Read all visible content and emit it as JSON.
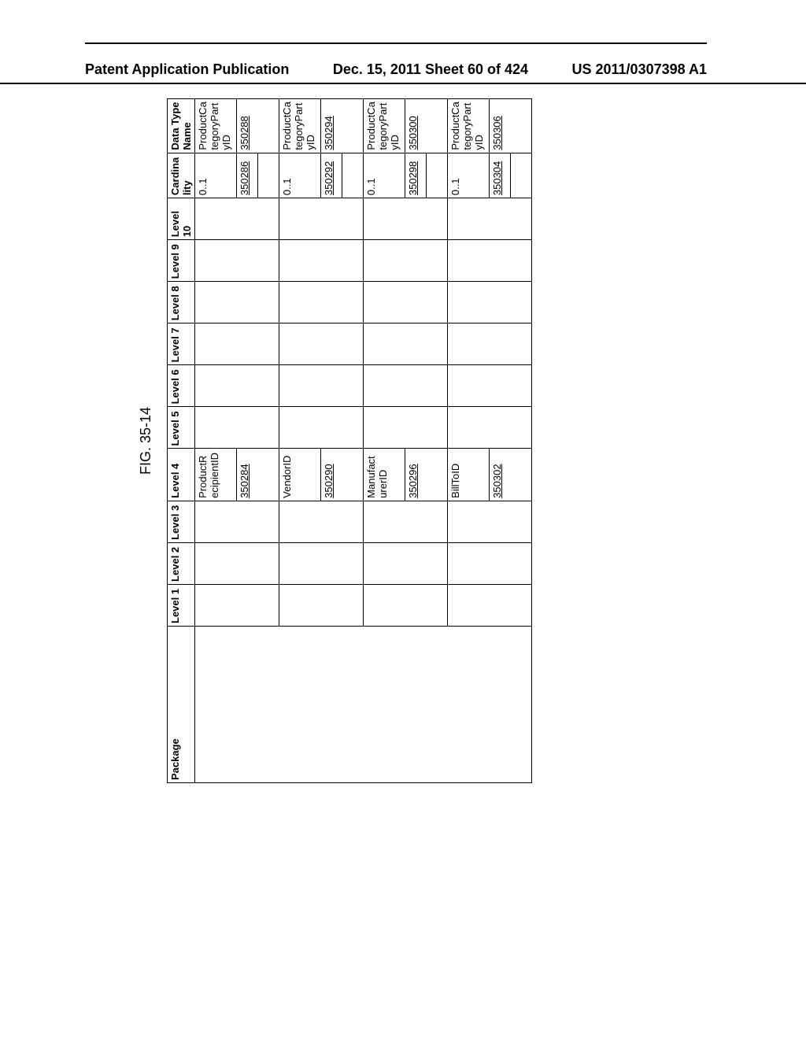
{
  "header": {
    "left": "Patent Application Publication",
    "center": "Dec. 15, 2011  Sheet 60 of 424",
    "right": "US 2011/0307398 A1"
  },
  "figure_label": "FIG. 35-14",
  "columns": {
    "package": "Package",
    "l1": "Level 1",
    "l2": "Level 2",
    "l3": "Level 3",
    "l4": "Level 4",
    "l5": "Level 5",
    "l6": "Level 6",
    "l7": "Level 7",
    "l8": "Level 8",
    "l9": "Level 9",
    "l10": "Level 10",
    "card": "Cardinality",
    "dtype": "Data Type Name"
  },
  "rows": [
    {
      "l4": "ProductRecipientID",
      "l4_num": "350284",
      "card": "0..1",
      "card_num": "350286",
      "dtype": "ProductCategoryPartyID",
      "dtype_num": "350288"
    },
    {
      "l4": "VendorID",
      "l4_num": "350290",
      "card": "0..1",
      "card_num": "350292",
      "dtype": "ProductCategoryPartyID",
      "dtype_num": "350294"
    },
    {
      "l4": "ManufacturerID",
      "l4_num": "350296",
      "card": "0..1",
      "card_num": "350298",
      "dtype": "ProductCategoryPartyID",
      "dtype_num": "350300"
    },
    {
      "l4": "BillToID",
      "l4_num": "350302",
      "card": "0..1",
      "card_num": "350304",
      "dtype": "ProductCategoryPartyID",
      "dtype_num": "350306"
    }
  ]
}
